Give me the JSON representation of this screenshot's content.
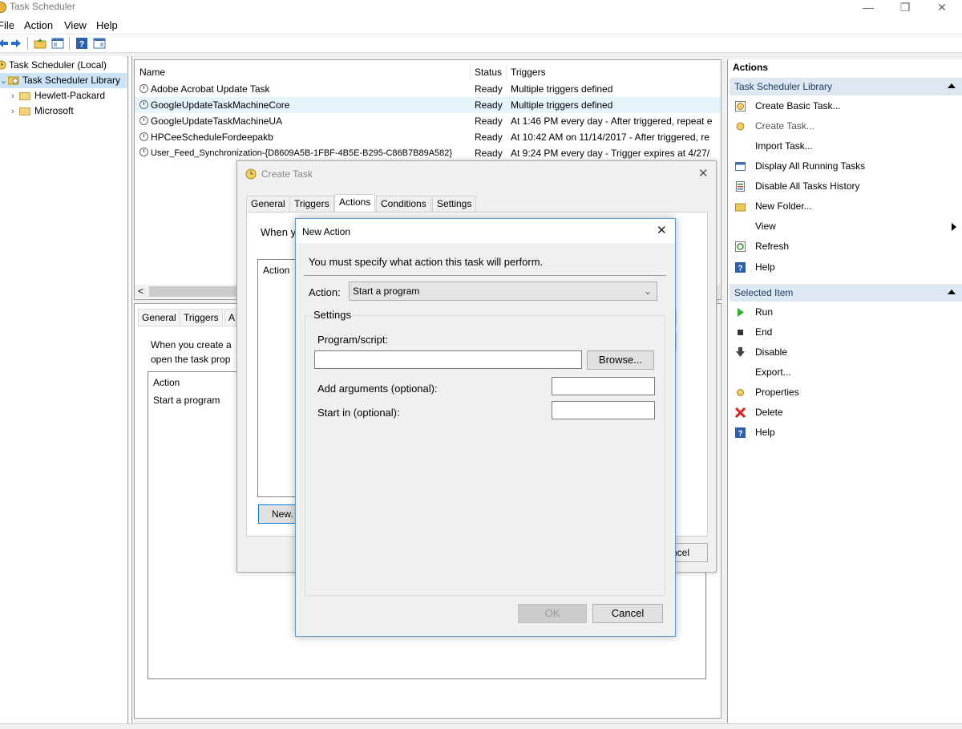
{
  "window": {
    "title": "Task Scheduler",
    "minimize_glyph": "—",
    "restore_glyph": "❐",
    "close_glyph": "✕"
  },
  "menu": [
    "File",
    "Action",
    "View",
    "Help"
  ],
  "toolbar_icons": [
    "back-icon",
    "forward-icon",
    "folder-up-icon",
    "show-hide-console-tree-icon",
    "help-icon",
    "show-hide-action-pane-icon"
  ],
  "tree": {
    "root": "Task Scheduler (Local)",
    "library": "Task Scheduler Library",
    "children": [
      "Hewlett-Packard",
      "Microsoft"
    ]
  },
  "task_list": {
    "columns": [
      "Name",
      "Status",
      "Triggers"
    ],
    "rows": [
      {
        "name": "Adobe Acrobat Update Task",
        "status": "Ready",
        "triggers": "Multiple triggers defined"
      },
      {
        "name": "GoogleUpdateTaskMachineCore",
        "status": "Ready",
        "triggers": "Multiple triggers defined"
      },
      {
        "name": "GoogleUpdateTaskMachineUA",
        "status": "Ready",
        "triggers": "At 1:46 PM every day - After triggered, repeat e"
      },
      {
        "name": "HPCeeScheduleFordeepakb",
        "status": "Ready",
        "triggers": "At 10:42 AM on 11/14/2017 - After triggered, re"
      },
      {
        "name": "User_Feed_Synchronization-{D8609A5B-1FBF-4B5E-B295-C86B7B89A582}",
        "status": "Ready",
        "triggers": "At 9:24 PM every day - Trigger expires at 4/27/"
      }
    ],
    "scroll_left": "<"
  },
  "detail": {
    "tabs": [
      "General",
      "Triggers",
      "A"
    ],
    "text_line1": "When you create a",
    "text_line2": "open the task prop",
    "list_header": "Action",
    "list_row": "Start a program"
  },
  "actions_pane": {
    "header": "Actions",
    "group1": "Task Scheduler Library",
    "items1": [
      {
        "label": "Create Basic Task...",
        "icon": "create-basic-task-icon",
        "dim": false
      },
      {
        "label": "Create Task...",
        "icon": "create-task-icon",
        "dim": true
      },
      {
        "label": "Import Task...",
        "icon": "",
        "dim": false
      },
      {
        "label": "Display All Running Tasks",
        "icon": "running-tasks-icon",
        "dim": false
      },
      {
        "label": "Disable All Tasks History",
        "icon": "tasks-history-icon",
        "dim": false
      },
      {
        "label": "New Folder...",
        "icon": "folder-icon",
        "dim": false
      },
      {
        "label": "View",
        "icon": "",
        "dim": false
      },
      {
        "label": "Refresh",
        "icon": "refresh-icon",
        "dim": false
      },
      {
        "label": "Help",
        "icon": "help-icon",
        "dim": false
      }
    ],
    "group2": "Selected Item",
    "items2": [
      {
        "label": "Run",
        "icon": "run-icon"
      },
      {
        "label": "End",
        "icon": "end-icon"
      },
      {
        "label": "Disable",
        "icon": "disable-icon"
      },
      {
        "label": "Export...",
        "icon": ""
      },
      {
        "label": "Properties",
        "icon": "properties-icon"
      },
      {
        "label": "Delete",
        "icon": "delete-icon"
      },
      {
        "label": "Help",
        "icon": "help-icon"
      }
    ]
  },
  "create_task": {
    "title": "Create Task",
    "tabs": [
      "General",
      "Triggers",
      "Actions",
      "Conditions",
      "Settings"
    ],
    "active_tab": "Actions",
    "when_text": "When y",
    "list_header": "Action",
    "new_button": "New.",
    "cancel_button": "ncel"
  },
  "new_action": {
    "title": "New Action",
    "instruction": "You must specify what action this task will perform.",
    "action_label": "Action:",
    "action_value": "Start a program",
    "settings_label": "Settings",
    "program_label": "Program/script:",
    "program_value": "",
    "browse_button": "Browse...",
    "arguments_label": "Add arguments (optional):",
    "arguments_value": "",
    "startin_label": "Start in (optional):",
    "startin_value": "",
    "ok_button": "OK",
    "cancel_button": "Cancel"
  },
  "colors": {
    "accent_border": "#5b9bd5",
    "group_header_bg": "#dde8f2",
    "selected_row_bg": "#e5f3fb",
    "delete_red": "#e02020",
    "run_green": "#2eae2e"
  }
}
